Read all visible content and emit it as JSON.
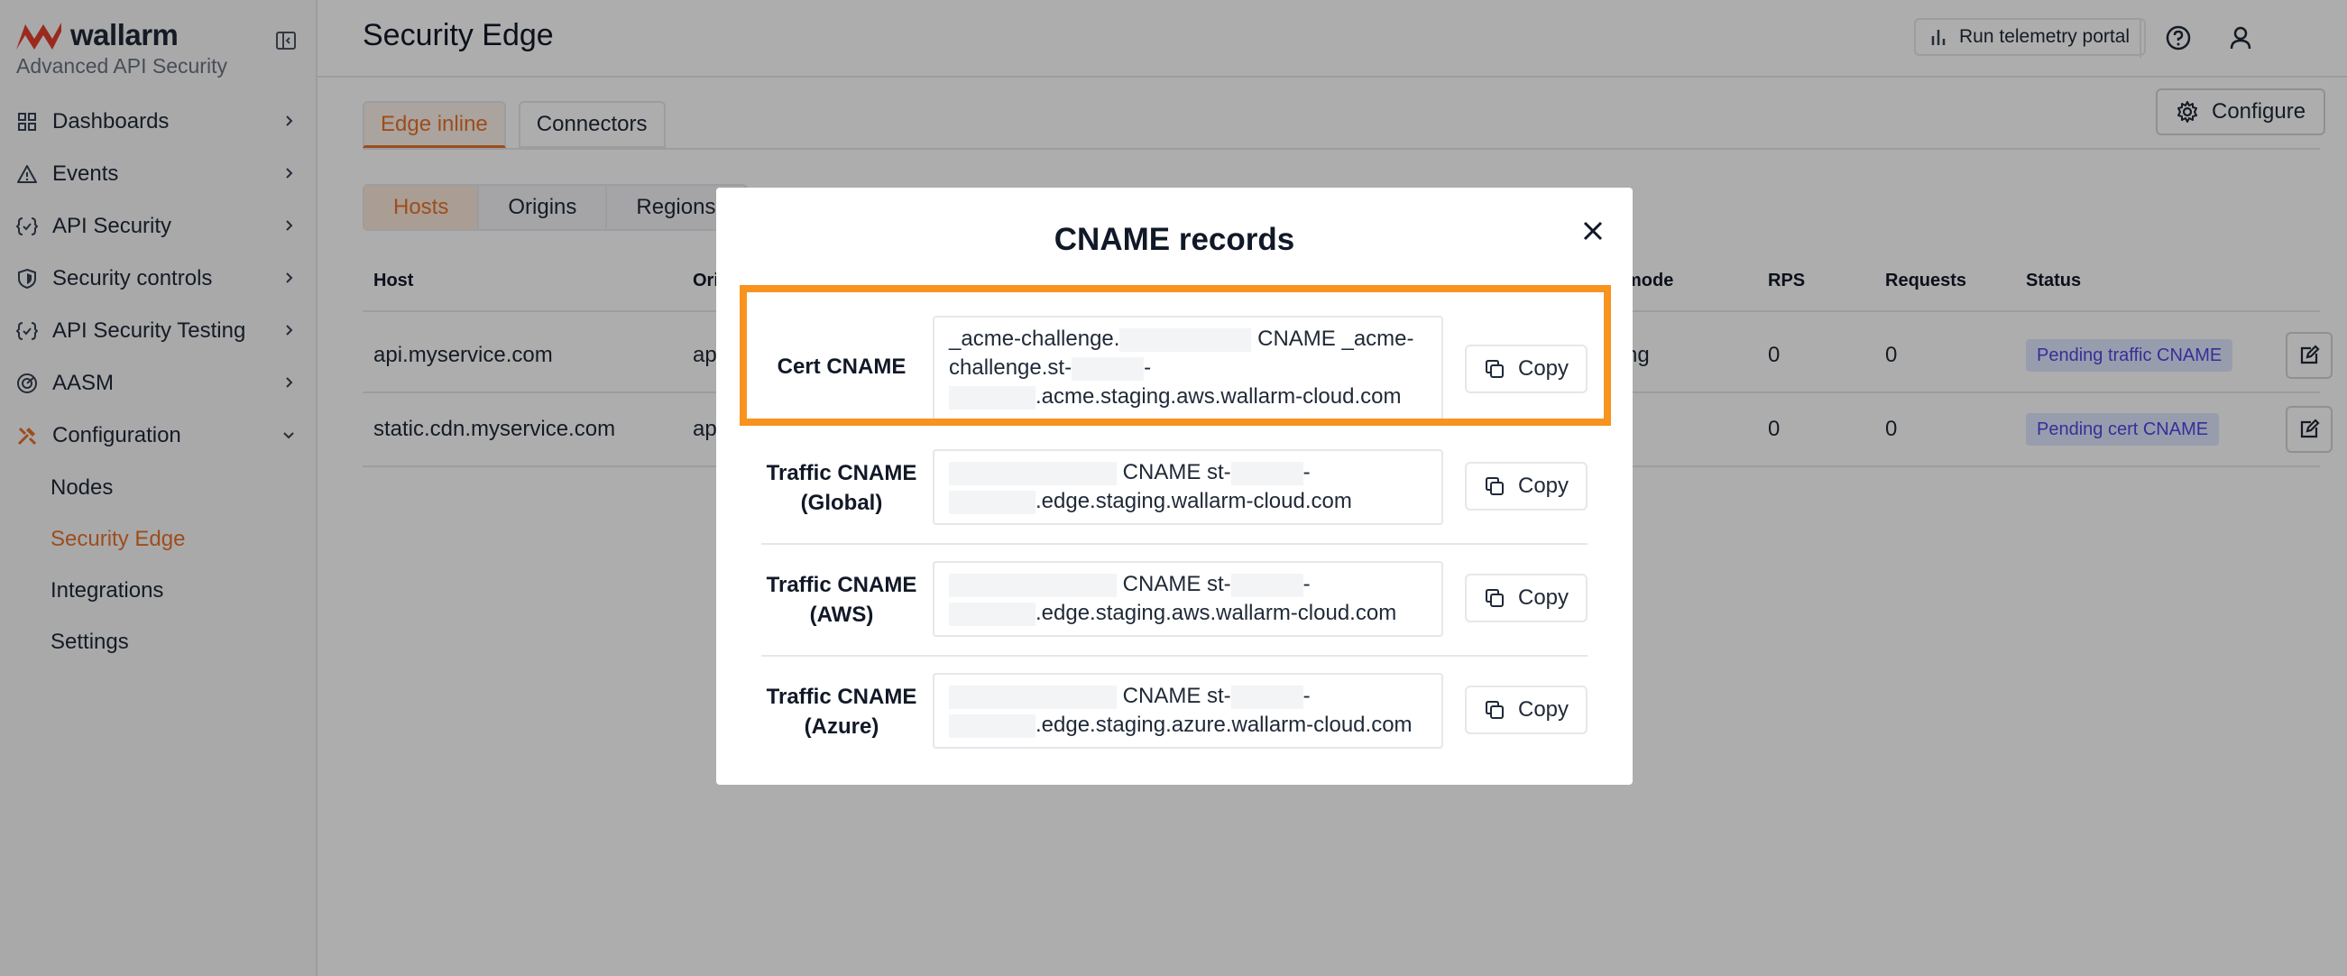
{
  "brand": {
    "name": "wallarm",
    "subtitle": "Advanced API Security"
  },
  "sidebar": {
    "items": [
      {
        "label": "Dashboards",
        "icon": "grid-icon"
      },
      {
        "label": "Events",
        "icon": "warning-icon"
      },
      {
        "label": "API Security",
        "icon": "api-brackets-icon"
      },
      {
        "label": "Security controls",
        "icon": "shield-icon"
      },
      {
        "label": "API Security Testing",
        "icon": "api-brackets-icon"
      },
      {
        "label": "AASM",
        "icon": "radar-icon"
      },
      {
        "label": "Configuration",
        "icon": "tools-icon"
      }
    ],
    "sub_items": [
      "Nodes",
      "Security Edge",
      "Integrations",
      "Settings"
    ],
    "active_sub": "Security Edge"
  },
  "header": {
    "title": "Security Edge",
    "telemetry_label": "Run telemetry portal"
  },
  "main_tabs": [
    "Edge inline",
    "Connectors"
  ],
  "configure_label": "Configure",
  "sub_tabs": [
    "Hosts",
    "Origins",
    "Regions"
  ],
  "table": {
    "headers": [
      "Host",
      "Ori",
      "mode",
      "RPS",
      "Requests",
      "Status"
    ],
    "rows": [
      {
        "host": "api.myservice.com",
        "origin": "ap",
        "mode": "ng",
        "rps": "0",
        "requests": "0",
        "status": "Pending traffic CNAME"
      },
      {
        "host": "static.cdn.myservice.com",
        "origin": "ap",
        "mode": "",
        "rps": "0",
        "requests": "0",
        "status": "Pending cert CNAME"
      }
    ]
  },
  "modal": {
    "title": "CNAME records",
    "copy_label": "Copy",
    "records": [
      {
        "label": "Cert CNAME",
        "line1a": "_acme-challenge.",
        "line1b": "CNAME _acme-",
        "line2a": "challenge.st-",
        "line2b": "-",
        "line3": ".acme.staging.aws.wallarm-cloud.com"
      },
      {
        "label_1": "Traffic CNAME",
        "label_2": "(Global)",
        "line1a": "CNAME st-",
        "line1b": "-",
        "line2": ".edge.staging.wallarm-cloud.com"
      },
      {
        "label_1": "Traffic CNAME",
        "label_2": "(AWS)",
        "line1a": "CNAME st-",
        "line1b": "-",
        "line2": ".edge.staging.aws.wallarm-cloud.com"
      },
      {
        "label_1": "Traffic CNAME",
        "label_2": "(Azure)",
        "line1a": "CNAME st-",
        "line1b": "-",
        "line2": ".edge.staging.azure.wallarm-cloud.com"
      }
    ]
  },
  "colors": {
    "accent": "#e8722c",
    "highlight": "#f7931e",
    "badge_bg": "#e0e7ff",
    "badge_text": "#4f46e5"
  }
}
